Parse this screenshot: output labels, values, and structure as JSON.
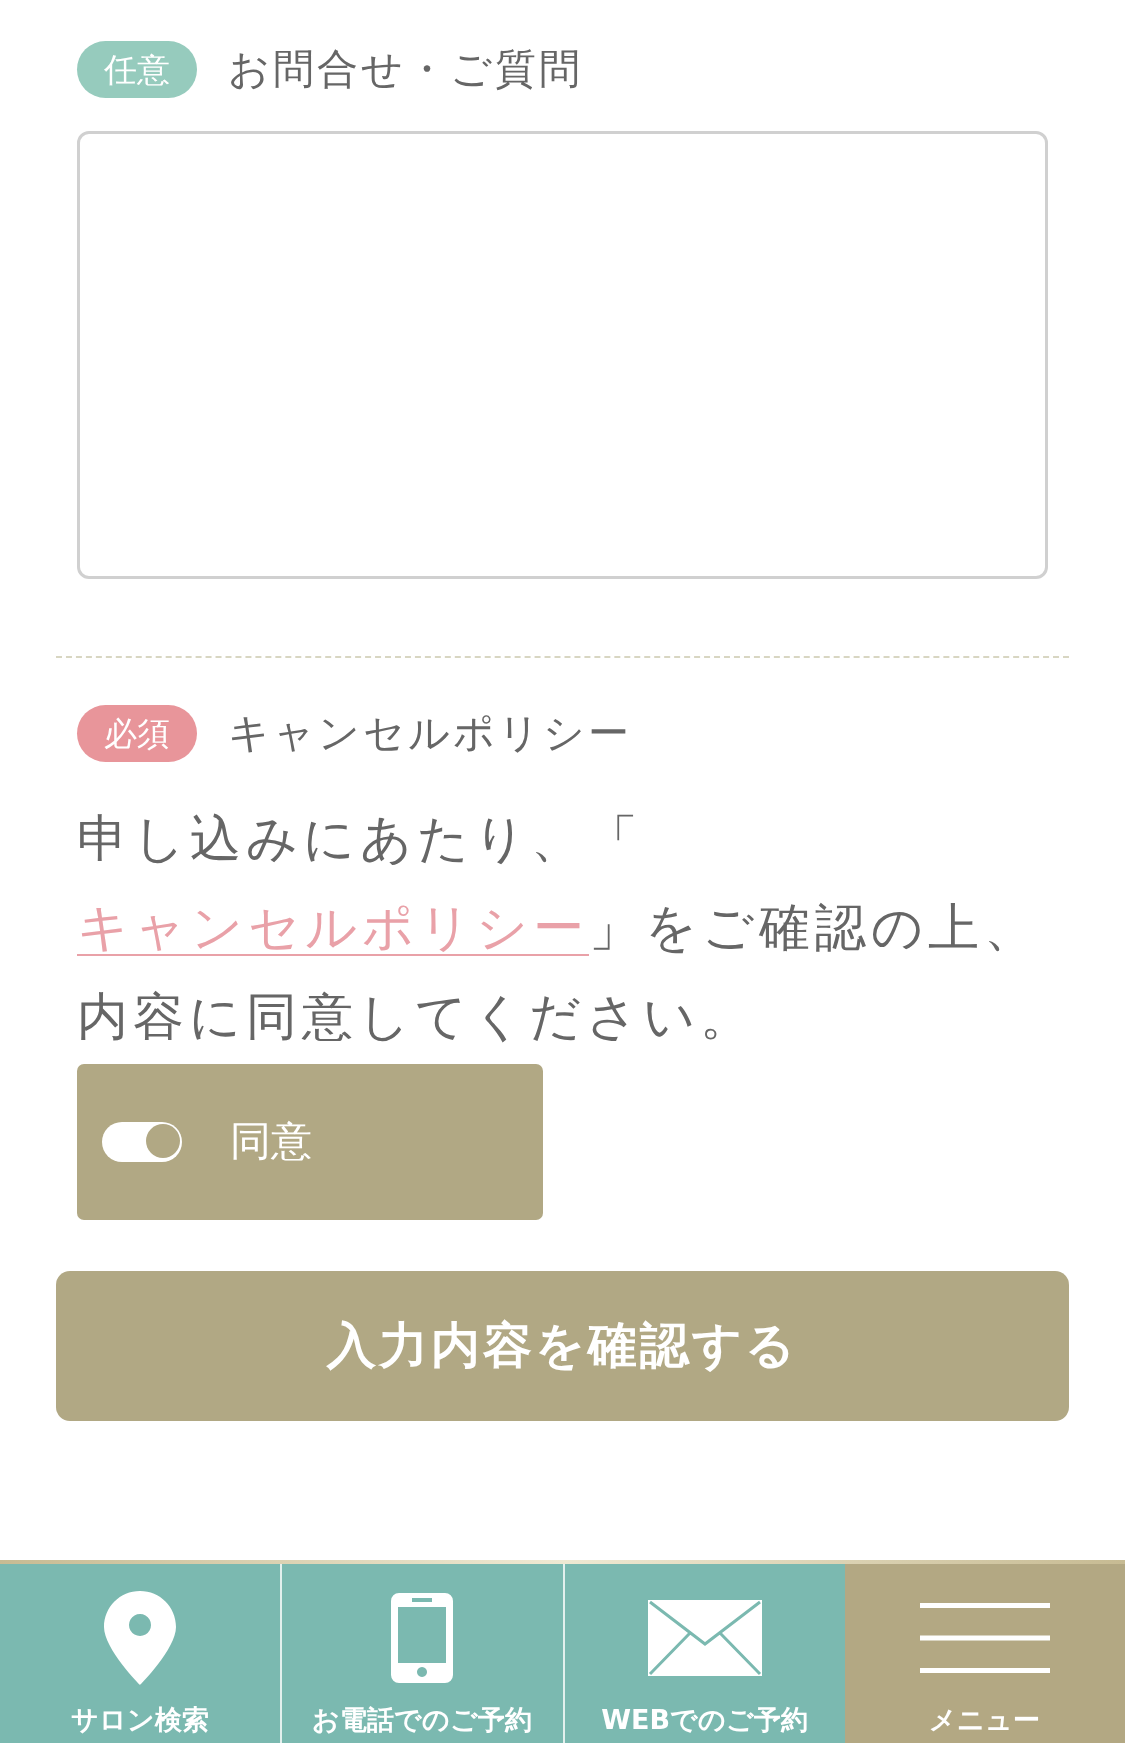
{
  "fields": [
    {
      "kind": "textarea",
      "required": false,
      "badge": "任意",
      "label": "お問合せ・ご質問"
    },
    {
      "kind": "agreement",
      "required": true,
      "badge": "必須",
      "label": "キャンセルポリシー",
      "notice_before": "申し込みにあたり、「",
      "notice_link": "キャンセルポリシー",
      "notice_after": "」をご確認の上、内容に同意してください。",
      "agree": {
        "label": "同意",
        "checked": true
      }
    }
  ],
  "submit_button": "入力内容を確認する",
  "bottom_nav": [
    {
      "kind": "location",
      "label": "サロン検索"
    },
    {
      "kind": "phone",
      "label": "お電話でのご予約"
    },
    {
      "kind": "mail",
      "label": "WEBでのご予約"
    },
    {
      "kind": "menu",
      "label": "メニュー"
    }
  ]
}
